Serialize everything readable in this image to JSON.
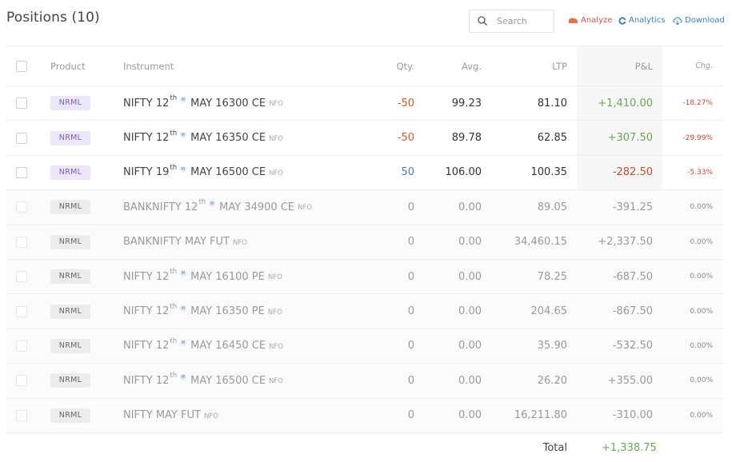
{
  "header": {
    "title": "Positions (10)",
    "search_placeholder": "Search",
    "analyze_label": "Analyze",
    "analytics_label": "Analytics",
    "download_label": "Download"
  },
  "colors": {
    "profit": "#6aa84f",
    "loss": "#d0452f",
    "badge_open_bg": "#ede7fb",
    "badge_closed_bg": "#ececec",
    "accent": "#387ed1",
    "analyze": "#d9534f"
  },
  "columns": {
    "product": "Product",
    "instrument": "Instrument",
    "qty": "Qty.",
    "avg": "Avg.",
    "ltp": "LTP",
    "pnl": "P&L",
    "chg": "Chg."
  },
  "rows": [
    {
      "product": "NRML",
      "name": "NIFTY 12",
      "sup": "th",
      "weekly": "W",
      "rest": "MAY 16300 CE",
      "exchange": "NFO",
      "qty": "-50",
      "avg": "99.23",
      "ltp": "81.10",
      "pnl": "+1,410.00",
      "chg": "-18.27%",
      "open": true
    },
    {
      "product": "NRML",
      "name": "NIFTY 12",
      "sup": "th",
      "weekly": "W",
      "rest": "MAY 16350 CE",
      "exchange": "NFO",
      "qty": "-50",
      "avg": "89.78",
      "ltp": "62.85",
      "pnl": "+307.50",
      "chg": "-29.99%",
      "open": true
    },
    {
      "product": "NRML",
      "name": "NIFTY 19",
      "sup": "th",
      "weekly": "W",
      "rest": "MAY 16500 CE",
      "exchange": "NFO",
      "qty": "50",
      "avg": "106.00",
      "ltp": "100.35",
      "pnl": "-282.50",
      "chg": "-5.33%",
      "open": true
    },
    {
      "product": "NRML",
      "name": "BANKNIFTY 12",
      "sup": "th",
      "weekly": "W",
      "rest": "MAY 34900 CE",
      "exchange": "NFO",
      "qty": "0",
      "avg": "0.00",
      "ltp": "89.05",
      "pnl": "-391.25",
      "chg": "0.00%",
      "open": false
    },
    {
      "product": "NRML",
      "name": "BANKNIFTY MAY FUT",
      "sup": "",
      "weekly": "",
      "rest": "",
      "exchange": "NFO",
      "qty": "0",
      "avg": "0.00",
      "ltp": "34,460.15",
      "pnl": "+2,337.50",
      "chg": "0.00%",
      "open": false
    },
    {
      "product": "NRML",
      "name": "NIFTY 12",
      "sup": "th",
      "weekly": "W",
      "rest": "MAY 16100 PE",
      "exchange": "NFO",
      "qty": "0",
      "avg": "0.00",
      "ltp": "78.25",
      "pnl": "-687.50",
      "chg": "0.00%",
      "open": false
    },
    {
      "product": "NRML",
      "name": "NIFTY 12",
      "sup": "th",
      "weekly": "W",
      "rest": "MAY 16350 PE",
      "exchange": "NFO",
      "qty": "0",
      "avg": "0.00",
      "ltp": "204.65",
      "pnl": "-867.50",
      "chg": "0.00%",
      "open": false
    },
    {
      "product": "NRML",
      "name": "NIFTY 12",
      "sup": "th",
      "weekly": "W",
      "rest": "MAY 16450 CE",
      "exchange": "NFO",
      "qty": "0",
      "avg": "0.00",
      "ltp": "35.90",
      "pnl": "-532.50",
      "chg": "0.00%",
      "open": false
    },
    {
      "product": "NRML",
      "name": "NIFTY 12",
      "sup": "th",
      "weekly": "W",
      "rest": "MAY 16500 CE",
      "exchange": "NFO",
      "qty": "0",
      "avg": "0.00",
      "ltp": "26.20",
      "pnl": "+355.00",
      "chg": "0.00%",
      "open": false
    },
    {
      "product": "NRML",
      "name": "NIFTY MAY FUT",
      "sup": "",
      "weekly": "",
      "rest": "",
      "exchange": "NFO",
      "qty": "0",
      "avg": "0.00",
      "ltp": "16,211.80",
      "pnl": "-310.00",
      "chg": "0.00%",
      "open": false
    }
  ],
  "footer": {
    "total_label": "Total",
    "total_value": "+1,338.75"
  }
}
